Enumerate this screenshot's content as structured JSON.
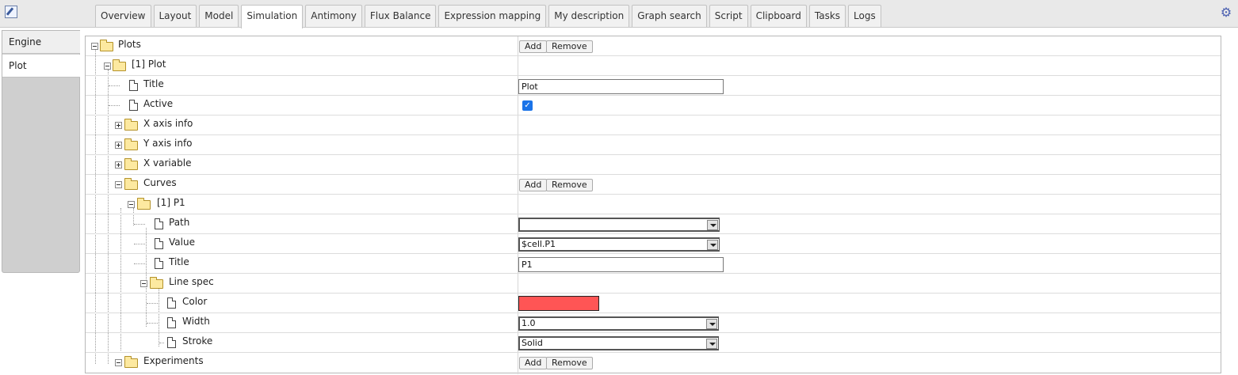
{
  "tabs": [
    {
      "label": "Overview",
      "active": false
    },
    {
      "label": "Layout",
      "active": false
    },
    {
      "label": "Model",
      "active": false
    },
    {
      "label": "Simulation",
      "active": true
    },
    {
      "label": "Antimony",
      "active": false
    },
    {
      "label": "Flux Balance",
      "active": false
    },
    {
      "label": "Expression mapping",
      "active": false
    },
    {
      "label": "My description",
      "active": false
    },
    {
      "label": "Graph search",
      "active": false
    },
    {
      "label": "Script",
      "active": false
    },
    {
      "label": "Clipboard",
      "active": false
    },
    {
      "label": "Tasks",
      "active": false
    },
    {
      "label": "Logs",
      "active": false
    }
  ],
  "side_tabs": [
    {
      "label": "Engine",
      "active": false
    },
    {
      "label": "Plot",
      "active": true
    }
  ],
  "buttons": {
    "add": "Add",
    "remove": "Remove"
  },
  "tree": {
    "plots": "Plots",
    "plot": "[1] Plot",
    "title": "Title",
    "title_value": "Plot",
    "active": "Active",
    "active_checked": true,
    "x_axis_info": "X axis info",
    "y_axis_info": "Y axis info",
    "x_variable": "X variable",
    "curves": "Curves",
    "curve": "[1] P1",
    "path": "Path",
    "path_value": "",
    "value": "Value",
    "value_value": "$cell.P1",
    "curve_title": "Title",
    "curve_title_value": "P1",
    "line_spec": "Line spec",
    "color": "Color",
    "color_value": "#ff5555",
    "width": "Width",
    "width_value": "1.0",
    "stroke": "Stroke",
    "stroke_value": "Solid",
    "experiments": "Experiments"
  },
  "icons": {
    "app": "edit-icon",
    "settings": "gear-icon",
    "folder": "folder-icon",
    "leaf": "document-icon"
  }
}
